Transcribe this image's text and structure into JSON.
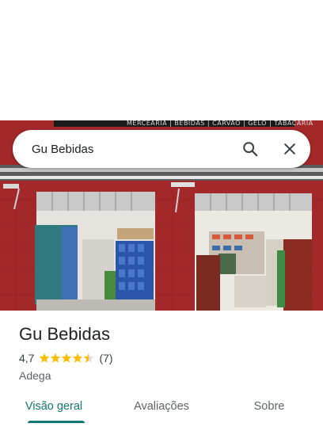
{
  "search": {
    "query": "Gu Bebidas"
  },
  "photo": {
    "sign_text": "MERCEARIA | BEBIDAS | CARVÃO | GELO | TABACARIA"
  },
  "place": {
    "name": "Gu Bebidas",
    "rating": "4,7",
    "rating_value": 4.7,
    "review_count": "(7)",
    "category": "Adega"
  },
  "tabs": [
    {
      "label": "Visão geral",
      "active": true
    },
    {
      "label": "Avaliações",
      "active": false
    },
    {
      "label": "Sobre",
      "active": false
    }
  ],
  "colors": {
    "accent": "#137672",
    "star": "#fbbc04",
    "wall": "#a82a2a"
  }
}
